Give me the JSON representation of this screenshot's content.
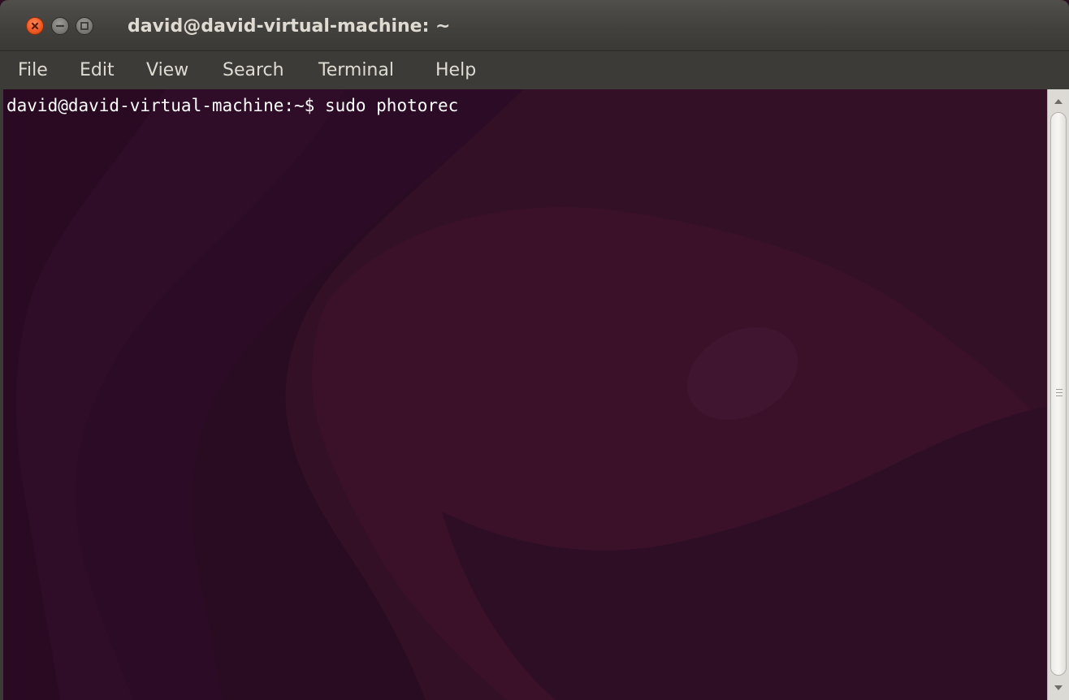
{
  "window": {
    "title": "david@david-virtual-machine: ~",
    "controls": [
      "close-icon",
      "minimize-icon",
      "maximize-icon"
    ]
  },
  "menu": {
    "items": [
      "File",
      "Edit",
      "View",
      "Search",
      "Terminal",
      "Help"
    ]
  },
  "terminal": {
    "prompt": "david@david-virtual-machine:~$",
    "command": "sudo photorec"
  },
  "colors": {
    "terminal_background": "#2c0d24",
    "terminal_text": "#ffffff",
    "titlebar": "#42413d",
    "close_button": "#f05a24"
  }
}
